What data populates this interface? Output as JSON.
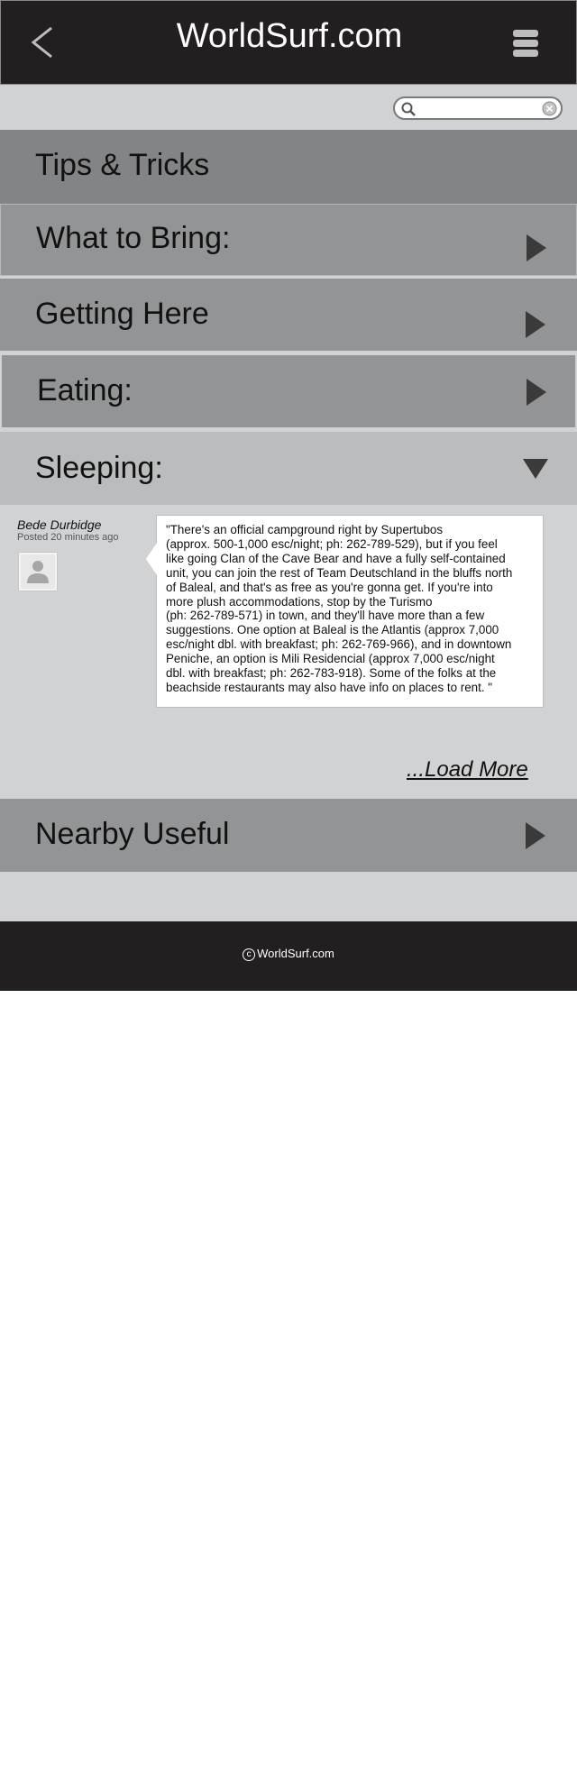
{
  "header": {
    "title": "WorldSurf.com",
    "back_icon": "chevron-left-icon",
    "menu_icon": "hamburger-menu-icon"
  },
  "search": {
    "placeholder": "",
    "value": ""
  },
  "sections": {
    "tips": {
      "label": "Tips & Tricks"
    },
    "what_to_bring": {
      "label": "What to Bring:",
      "state": "collapsed"
    },
    "getting_here": {
      "label": "Getting Here",
      "state": "collapsed"
    },
    "eating": {
      "label": "Eating:",
      "state": "collapsed"
    },
    "sleeping": {
      "label": "Sleeping:",
      "state": "expanded"
    },
    "nearby_useful": {
      "label": "Nearby Useful",
      "state": "collapsed"
    }
  },
  "comment": {
    "author": "Bede Durbidge",
    "posted": "Posted 20 minutes ago",
    "text": "\"There's an official campground right by Supertubos\n(approx. 500-1,000 esc/night; ph: 262-789-529), but if you feel\nlike going Clan of the Cave Bear and have a fully self-contained\nunit, you can join the rest of Team Deutschland in the bluffs north\nof Baleal, and that's as free as you're gonna get. If you're into\nmore plush accommodations, stop by the Turismo\n(ph: 262-789-571) in town, and they'll have more than a few\nsuggestions. One option at Baleal is the Atlantis (approx 7,000\nesc/night dbl. with breakfast; ph: 262-769-966), and in downtown\n Peniche, an option is Mili Residencial (approx 7,000 esc/night\ndbl. with breakfast; ph: 262-783-918). Some of the folks at the\nbeachside restaurants may also have info on places to rent. \""
  },
  "load_more": {
    "label": "...Load More"
  },
  "footer": {
    "copyright": "WorldSurf.com"
  },
  "colors": {
    "header_bg": "#231f20",
    "page_gray": "#d1d2d4",
    "section_dark": "#838486",
    "section_mid": "#939495",
    "sleeping_bg": "#bbbcbe",
    "arrow": "#3a3a3a"
  }
}
